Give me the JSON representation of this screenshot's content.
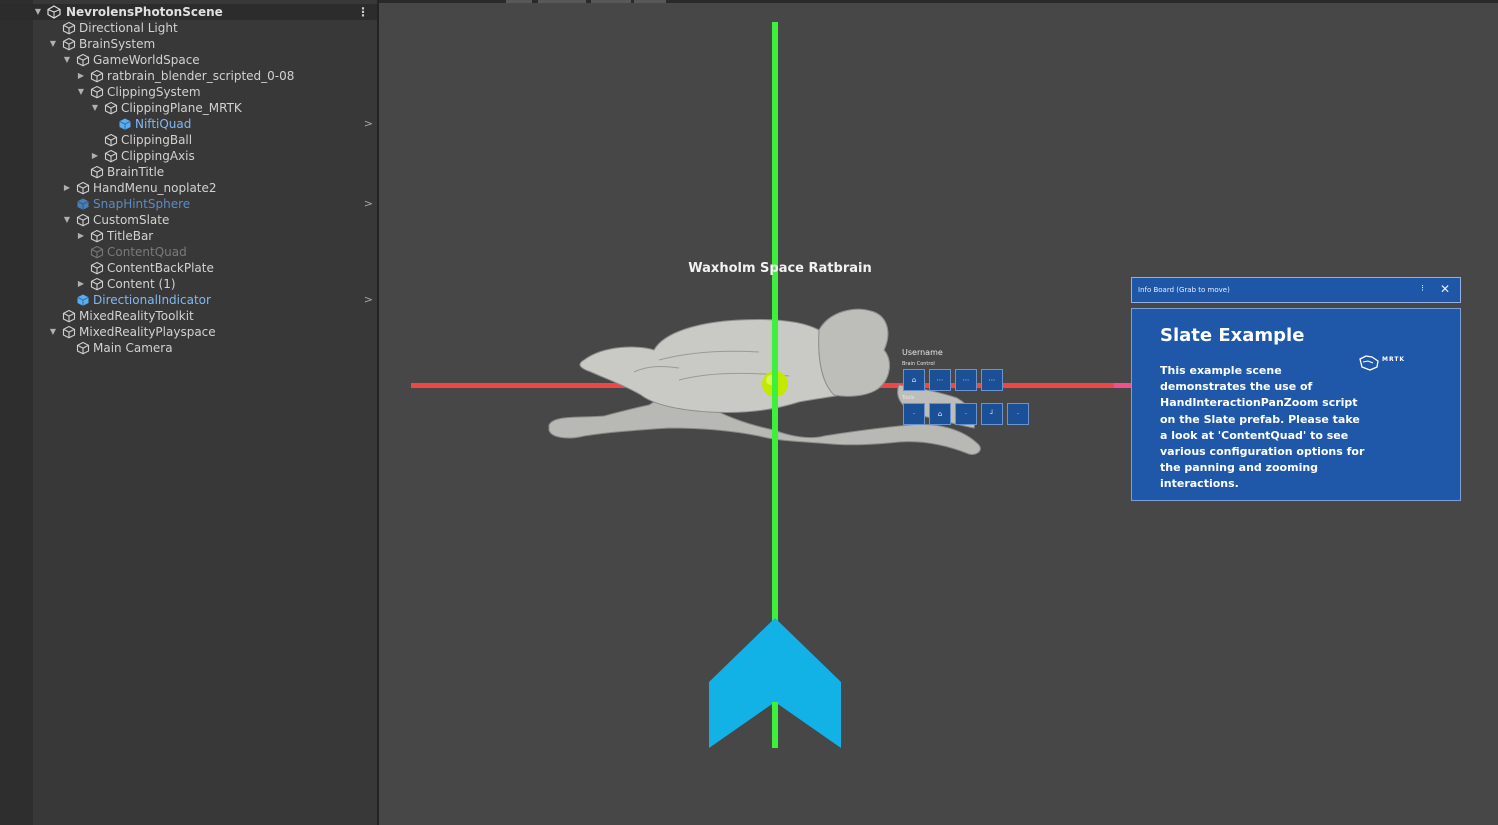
{
  "hierarchy": {
    "scene_name": "NevrolensPhotonScene",
    "items": [
      {
        "label": "Directional Light"
      },
      {
        "label": "BrainSystem"
      },
      {
        "label": "GameWorldSpace"
      },
      {
        "label": "ratbrain_blender_scripted_0-08"
      },
      {
        "label": "ClippingSystem"
      },
      {
        "label": "ClippingPlane_MRTK"
      },
      {
        "label": "NiftiQuad"
      },
      {
        "label": "ClippingBall"
      },
      {
        "label": "ClippingAxis"
      },
      {
        "label": "BrainTitle"
      },
      {
        "label": "HandMenu_noplate2"
      },
      {
        "label": "SnapHintSphere"
      },
      {
        "label": "CustomSlate"
      },
      {
        "label": "TitleBar"
      },
      {
        "label": "ContentQuad"
      },
      {
        "label": "ContentBackPlate"
      },
      {
        "label": "Content (1)"
      },
      {
        "label": "DirectionalIndicator"
      },
      {
        "label": "MixedRealityToolkit"
      },
      {
        "label": "MixedRealityPlayspace"
      },
      {
        "label": "Main Camera"
      }
    ]
  },
  "scene": {
    "brain_title": "Waxholm Space Ratbrain",
    "hand_menu": {
      "username": "Username",
      "brain_control_label": "Brain Control",
      "tools_label": "Tools"
    },
    "slate": {
      "titlebar": "Info Board    (Grab to move)",
      "heading": "Slate Example",
      "body": "This example scene demonstrates the use of HandInteractionPanZoom script on the Slate prefab. Please take a look at 'ContentQuad' to see various configuration options for the panning and zooming interactions.",
      "logo_text": "MRTK"
    }
  },
  "colors": {
    "axis_y": "#3cf03c",
    "axis_x": "#f04646",
    "indicator": "#12b2e6",
    "ball": "#c4e800",
    "slate": "#1f58a8",
    "selected_text": "#7fb8f4"
  }
}
